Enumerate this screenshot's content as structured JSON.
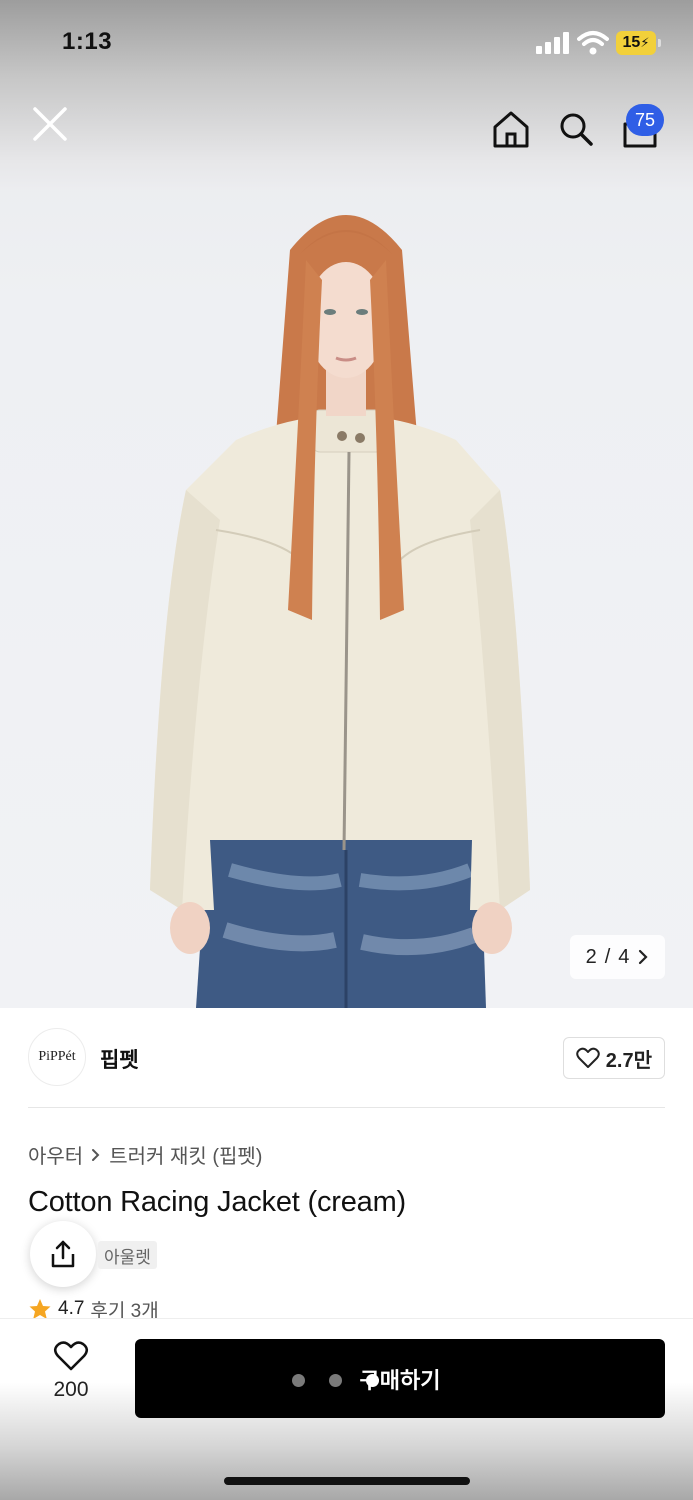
{
  "status_bar": {
    "time": "1:13",
    "battery": "15"
  },
  "nav": {
    "cart_count": "75"
  },
  "gallery": {
    "current": "2",
    "separator": "/",
    "total": "4"
  },
  "brand": {
    "logo_text": "PiPPét",
    "name": "핍펫",
    "likes": "2.7만"
  },
  "breadcrumb": {
    "category": "아우터",
    "subcategory": "트러커 재킷 (핍펫)"
  },
  "product": {
    "title": "Cotton Racing Jacket (cream)",
    "tag": "아울렛",
    "rating": "4.7",
    "reviews": "후기 3개"
  },
  "bottom_bar": {
    "wish_count": "200",
    "buy_label": "구매하기"
  },
  "colors": {
    "accent_badge": "#2f5ee6",
    "buy_button": "#000000",
    "star": "#f5a623"
  },
  "icons": [
    "close-icon",
    "home-icon",
    "search-icon",
    "cart-icon",
    "heart-icon",
    "share-icon",
    "star-icon",
    "chevron-right-icon"
  ]
}
